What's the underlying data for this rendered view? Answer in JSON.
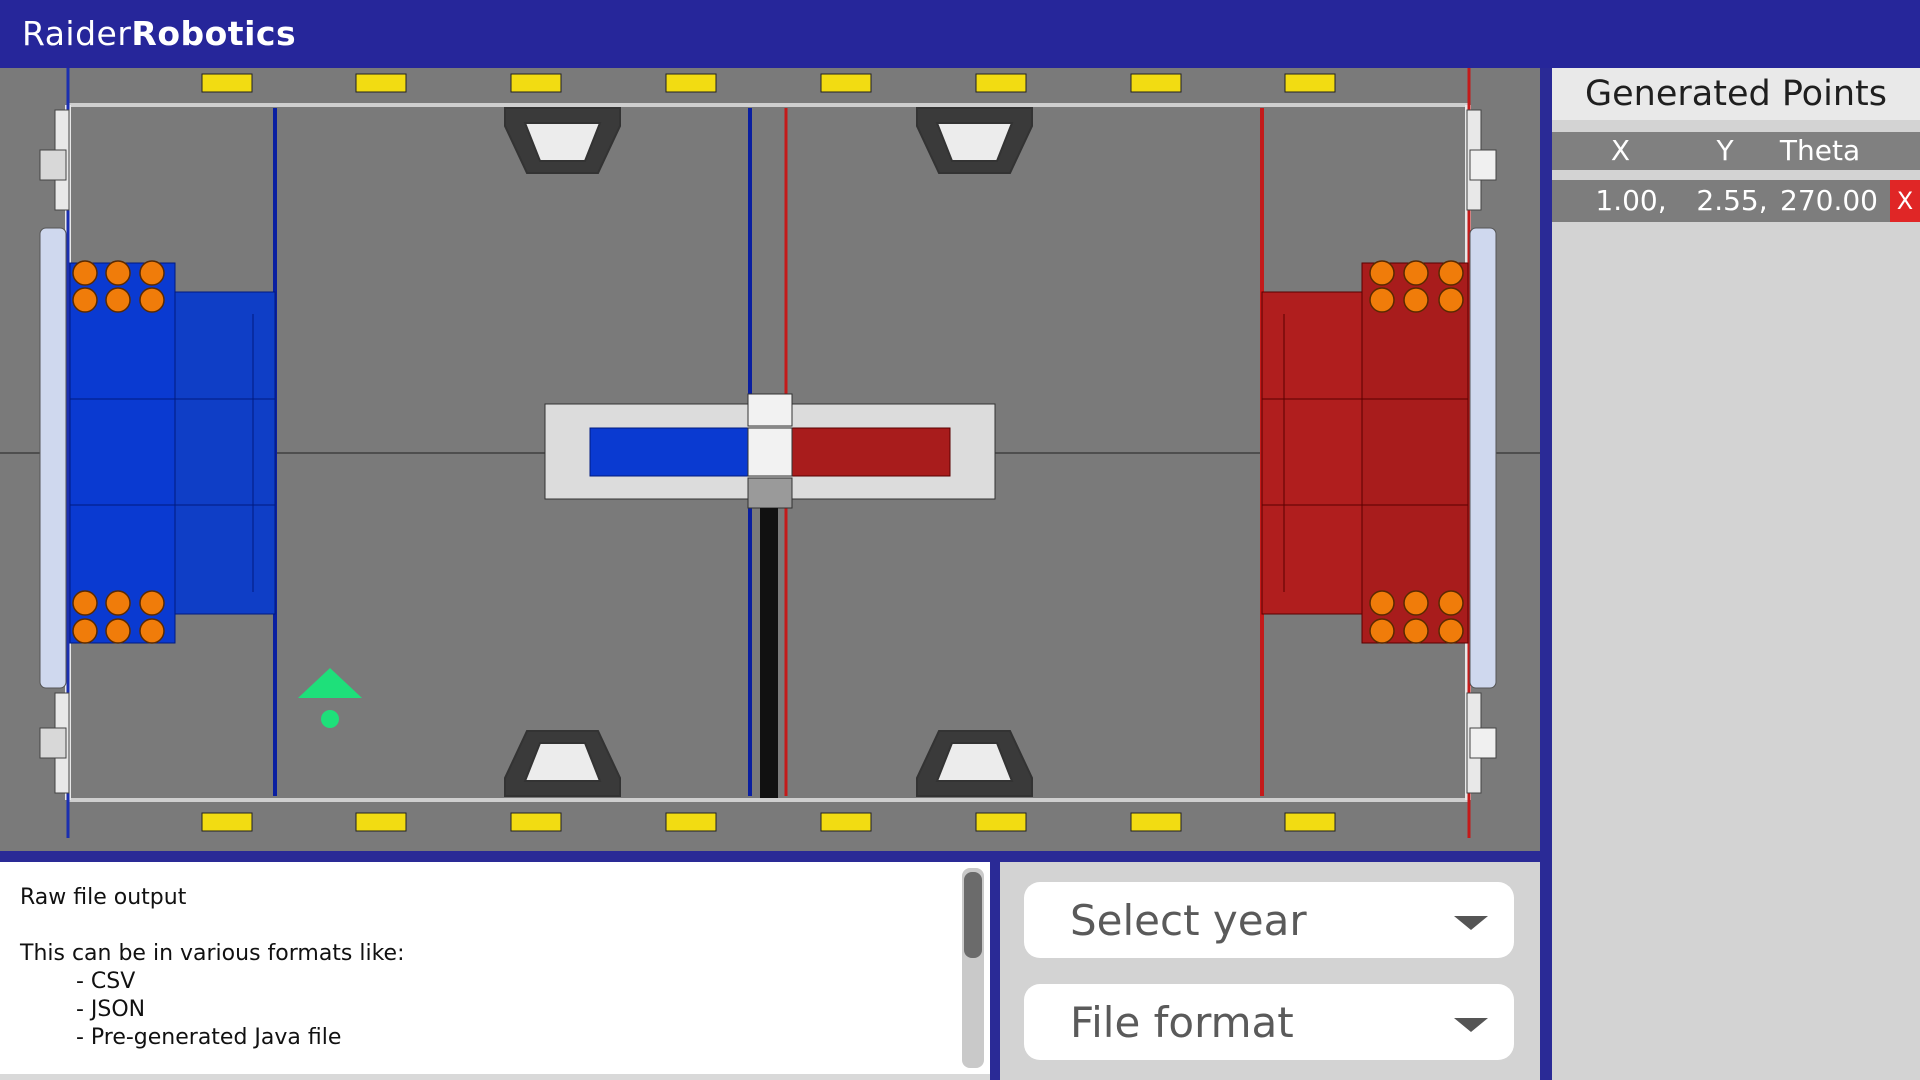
{
  "header": {
    "brand_light": "Raider",
    "brand_bold": "Robotics"
  },
  "panel": {
    "title": "Generated Points",
    "columns": {
      "x": "X",
      "y": "Y",
      "theta": "Theta"
    },
    "points": [
      {
        "x": "1.00,",
        "y": "2.55,",
        "theta": "270.00",
        "delete": "X"
      }
    ]
  },
  "output": {
    "text": "Raw file output\n\nThis can be in various formats like:\n        - CSV\n        - JSON\n        - Pre-generated Java file"
  },
  "controls": {
    "year_label": "Select year",
    "format_label": "File format"
  },
  "colors": {
    "header": "#26269a",
    "field": "#7a7a7a",
    "blue_alliance": "#0a3ad1",
    "red_alliance": "#a81c1c",
    "robot_marker": "#1ee07a",
    "delete": "#e02626"
  },
  "icons": {
    "robot_marker": "triangle-up-with-dot",
    "dropdown": "chevron-down-icon"
  }
}
